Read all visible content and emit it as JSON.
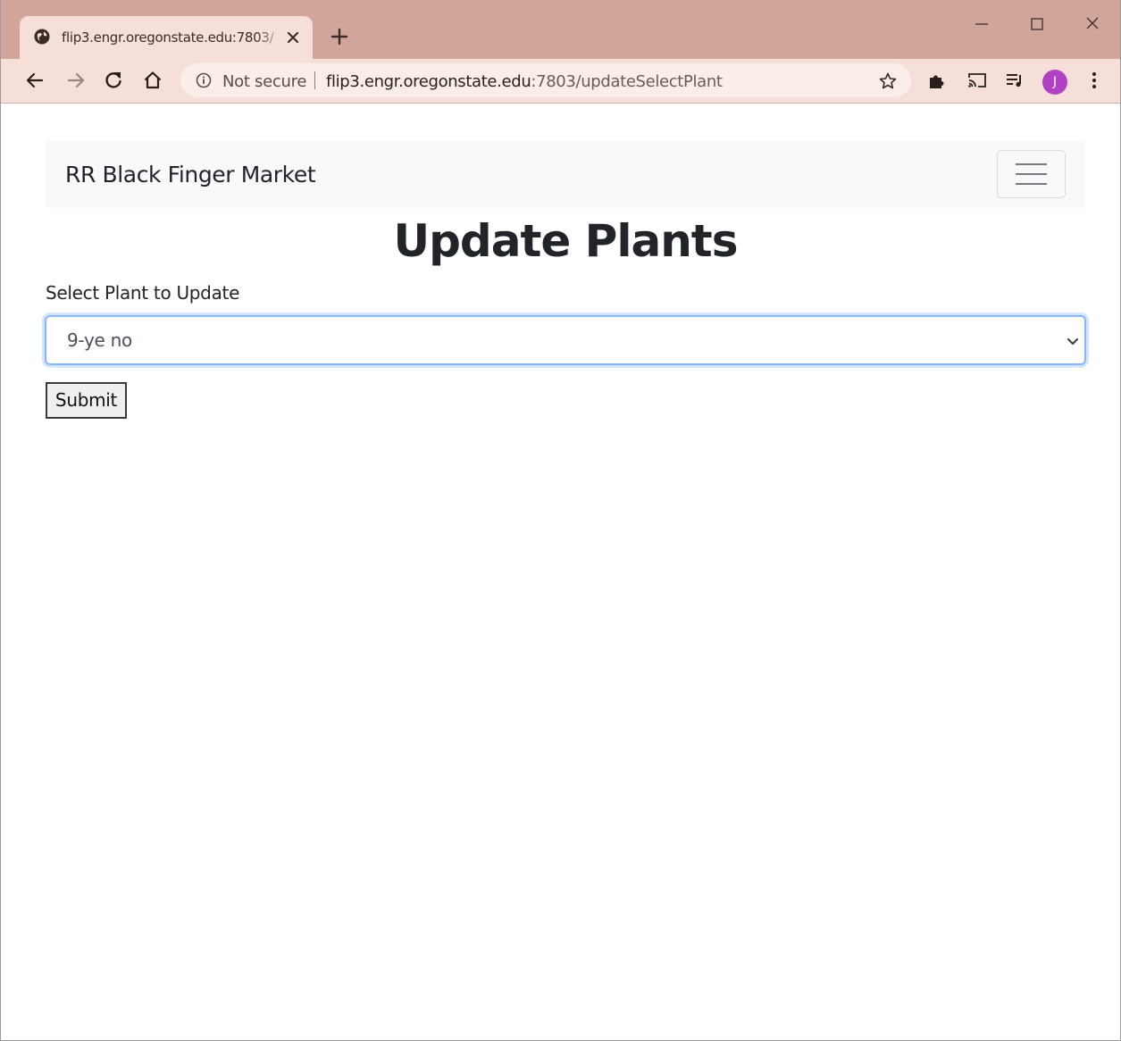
{
  "browser": {
    "tab": {
      "title": "flip3.engr.oregonstate.edu:7803/"
    },
    "toolbar": {
      "security_label": "Not secure",
      "url_host": "flip3.engr.oregonstate.edu",
      "url_path": ":7803/updateSelectPlant",
      "profile_initial": "J"
    },
    "colors": {
      "frame": "#d2a59b",
      "toolbar": "#f6dfd8",
      "avatar": "#b341c4"
    }
  },
  "navbar": {
    "brand": "RR Black Finger Market"
  },
  "main": {
    "title": "Update Plants",
    "select_label": "Select Plant to Update",
    "selected_plant": "9-ye no",
    "submit_label": "Submit"
  }
}
